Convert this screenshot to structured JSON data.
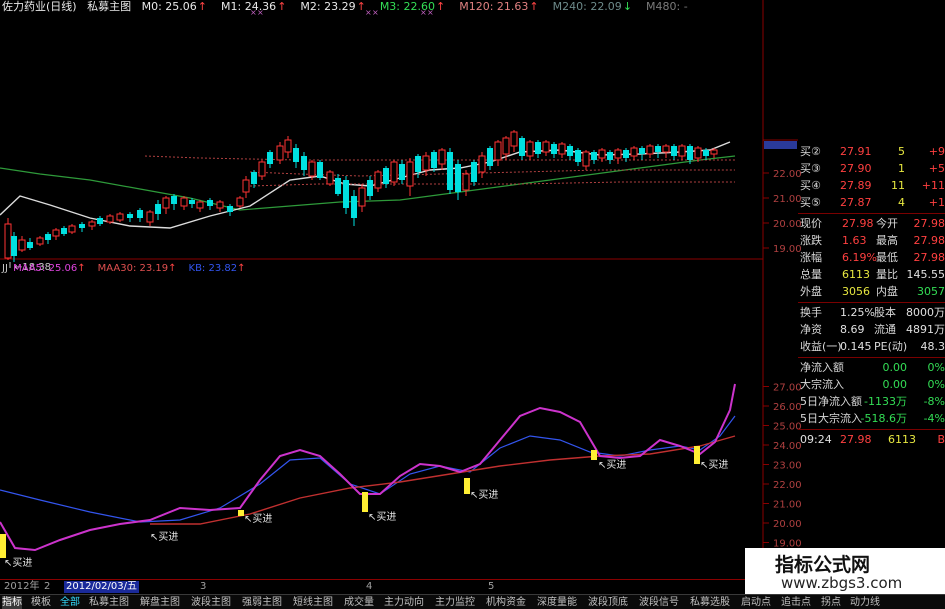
{
  "header": {
    "stock_name": "佐力药业(日线)",
    "indicator_name": "私募主图",
    "ma_items": [
      {
        "label": "M0: 25.06",
        "arrow": "↑",
        "color": "#e8e8e8"
      },
      {
        "label": "M1: 24.36",
        "arrow": "↑",
        "color": "#e8e8e8"
      },
      {
        "label": "M2: 23.29",
        "arrow": "↑",
        "color": "#e8e8e8"
      },
      {
        "label": "M3: 22.60",
        "arrow": "↑",
        "color": "#33dd55"
      },
      {
        "label": "M120: 21.63",
        "arrow": "↑",
        "color": "#e08080"
      },
      {
        "label": "M240: 22.09",
        "arrow": "↓",
        "color": "#6d8a8a"
      },
      {
        "label": "M480: -",
        "arrow": "",
        "color": "#7a7a7a"
      }
    ]
  },
  "sub_header": {
    "title": "JJ",
    "items": [
      {
        "label": "MAA5: 25.06",
        "arrow": "↑",
        "color": "#dd44dd"
      },
      {
        "label": "MAA30: 23.19",
        "arrow": "↑",
        "color": "#e05050"
      },
      {
        "label": "KB: 23.82",
        "arrow": "↑",
        "color": "#3355ee"
      }
    ]
  },
  "main_axis": [
    "22.00",
    "21.00",
    "20.00",
    "19.00"
  ],
  "sub_axis": [
    "27.00",
    "26.00",
    "25.00",
    "24.00",
    "23.00",
    "22.00",
    "21.00",
    "20.00",
    "19.00",
    "18.00"
  ],
  "low_marker": "18.38",
  "buy_label": "买进",
  "quote": {
    "bids": [
      {
        "label": "买②",
        "price": "27.91",
        "vol": "5",
        "chg": "+9"
      },
      {
        "label": "买③",
        "price": "27.90",
        "vol": "1",
        "chg": "+5"
      },
      {
        "label": "买④",
        "price": "27.89",
        "vol": "11",
        "chg": "+11"
      },
      {
        "label": "买⑤",
        "price": "27.87",
        "vol": "4",
        "chg": "+1"
      }
    ],
    "stats": [
      {
        "l1": "现价",
        "v1": "27.98",
        "l2": "今开",
        "v2": "27.98"
      },
      {
        "l1": "涨跌",
        "v1": "1.63",
        "l2": "最高",
        "v2": "27.98"
      },
      {
        "l1": "涨幅",
        "v1": "6.19%",
        "l2": "最低",
        "v2": "27.98"
      },
      {
        "l1": "总量",
        "v1": "6113",
        "l2": "量比",
        "v2": "145.55"
      },
      {
        "l1": "外盘",
        "v1": "3056",
        "l2": "内盘",
        "v2": "3057"
      }
    ],
    "stats2": [
      {
        "l1": "换手",
        "v1": "1.25%",
        "l2": "股本",
        "v2": "8000万"
      },
      {
        "l1": "净资",
        "v1": "8.69",
        "l2": "流通",
        "v2": "4891万"
      },
      {
        "l1": "收益(一)",
        "v1": "0.145",
        "l2": "PE(动)",
        "v2": "48.3"
      }
    ],
    "flows": [
      {
        "label": "净流入额",
        "v1": "0.00",
        "v2": "0%"
      },
      {
        "label": "大宗流入",
        "v1": "0.00",
        "v2": "0%"
      },
      {
        "label": "5日净流入额",
        "v1": "-1133万",
        "v2": "-8%"
      },
      {
        "label": "5日大宗流入",
        "v1": "-518.6万",
        "v2": "-4%"
      }
    ],
    "tick": {
      "time": "09:24",
      "price": "27.98",
      "vol": "6113",
      "flag": "B"
    }
  },
  "date_bar": {
    "year": "2012年",
    "m2": "2",
    "selected_date": "2012/02/03/五",
    "m3": "3",
    "m4": "4",
    "m5": "5"
  },
  "tabs": [
    "指标",
    "模板",
    "全部",
    "私募主图",
    "解盘主图",
    "波段主图",
    "强弱主图",
    "短线主图",
    "成交量",
    "主力动向",
    "主力监控",
    "机构资金",
    "深度量能",
    "波段顶底",
    "波段信号",
    "私募选股",
    "启动点",
    "追击点",
    "拐点",
    "动力线"
  ],
  "watermark": {
    "title": "指标公式网",
    "url": "www.zbgs3.com"
  },
  "colors": {
    "up": "#ff3333",
    "down": "#00e0e0",
    "buy_marker": "#ffee33",
    "grid": "#8a0000"
  }
}
